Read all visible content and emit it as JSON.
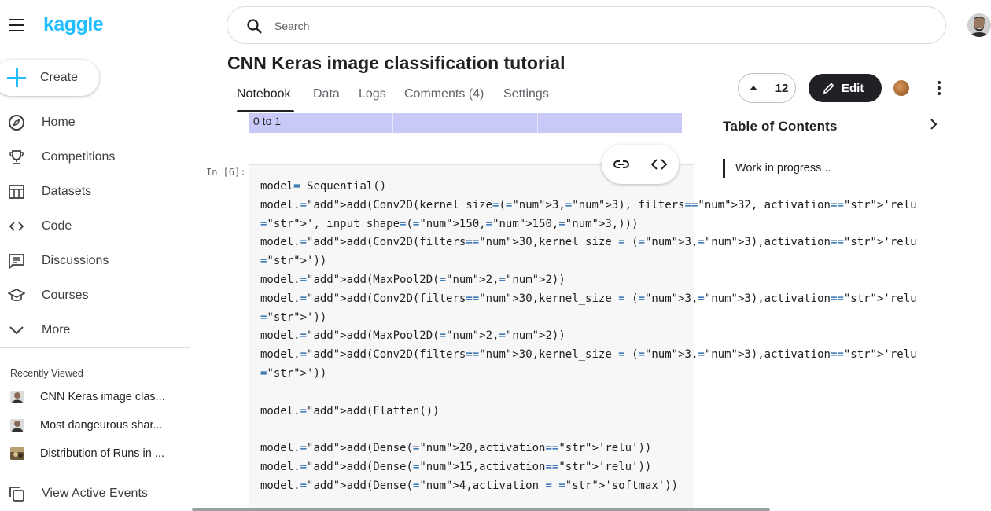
{
  "app": {
    "logo": "kaggle"
  },
  "sidebar": {
    "create_label": "Create",
    "items": [
      {
        "label": "Home",
        "icon": "compass-icon"
      },
      {
        "label": "Competitions",
        "icon": "trophy-icon"
      },
      {
        "label": "Datasets",
        "icon": "table-icon"
      },
      {
        "label": "Code",
        "icon": "code-icon"
      },
      {
        "label": "Discussions",
        "icon": "comment-icon"
      },
      {
        "label": "Courses",
        "icon": "school-icon"
      },
      {
        "label": "More",
        "icon": "chevron-down-icon"
      }
    ],
    "recently_viewed_title": "Recently Viewed",
    "recent": [
      {
        "label": "CNN Keras image clas..."
      },
      {
        "label": "Most dangeurous shar..."
      },
      {
        "label": "Distribution of Runs in ..."
      }
    ],
    "view_events_label": "View Active Events"
  },
  "search": {
    "placeholder": "Search"
  },
  "notebook": {
    "title": "CNN Keras image classification tutorial",
    "tabs": [
      "Notebook",
      "Data",
      "Logs",
      "Comments (4)",
      "Settings"
    ],
    "active_tab": "Notebook",
    "vote_count": "12",
    "edit_label": "Edit",
    "table_strip_text": "0 to 1",
    "cell_prompt": "In [6]:",
    "code_lines": [
      "model= Sequential()",
      "model.add(Conv2D(kernel_size=(3,3), filters=32, activation='relu",
      "', input_shape=(150,150,3,)))",
      "model.add(Conv2D(filters=30,kernel_size = (3,3),activation='relu",
      "'))",
      "model.add(MaxPool2D(2,2))",
      "model.add(Conv2D(filters=30,kernel_size = (3,3),activation='relu",
      "'))",
      "model.add(MaxPool2D(2,2))",
      "model.add(Conv2D(filters=30,kernel_size = (3,3),activation='relu",
      "'))",
      "",
      "model.add(Flatten())",
      "",
      "model.add(Dense(20,activation='relu'))",
      "model.add(Dense(15,activation='relu'))",
      "model.add(Dense(4,activation = 'softmax'))"
    ]
  },
  "toc": {
    "title": "Table of Contents",
    "items": [
      "Work in progress..."
    ]
  },
  "colors": {
    "accent": "#20beff",
    "dark": "#202124",
    "table_header": "#c9c9f7"
  }
}
